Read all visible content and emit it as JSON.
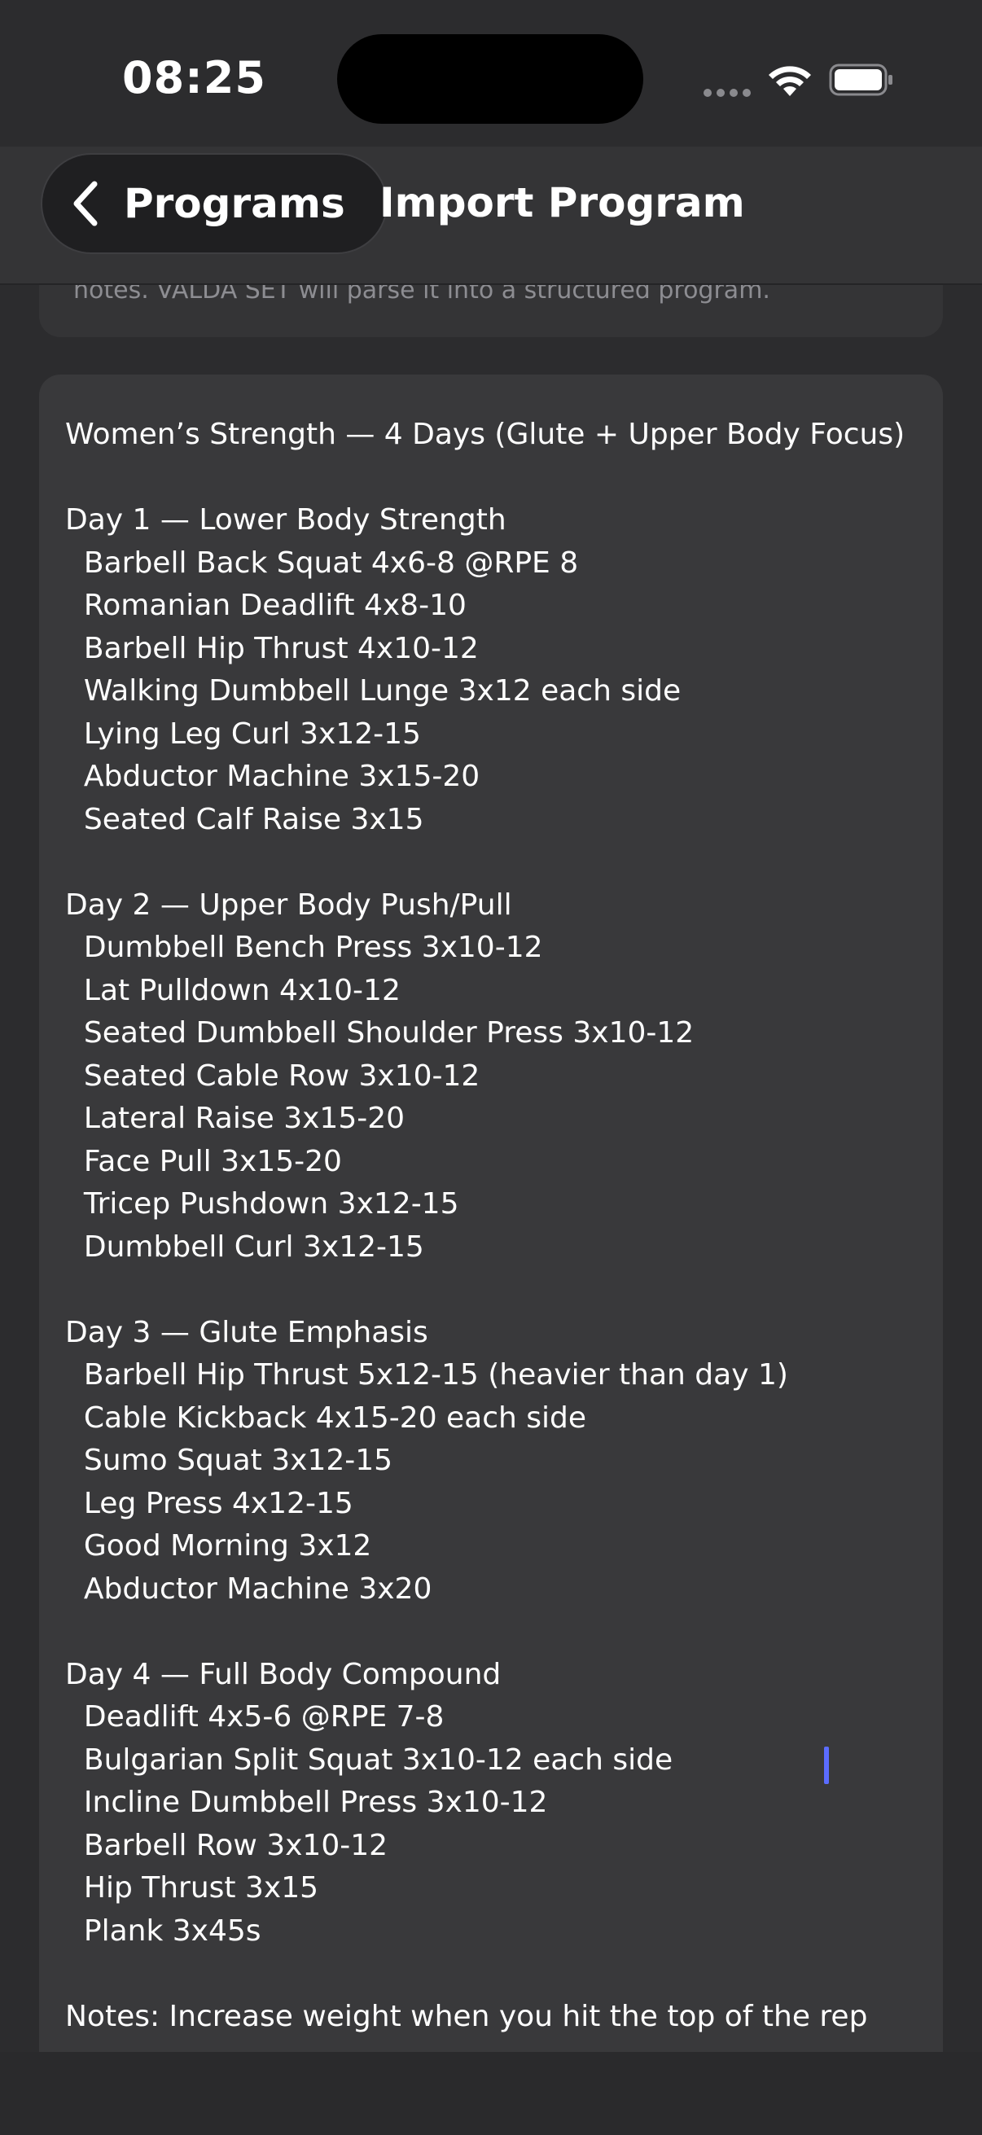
{
  "status_bar": {
    "time": "08:25"
  },
  "nav": {
    "back_label": "Programs",
    "title": "Import Program"
  },
  "info": {
    "text": "notes. VALDA SET will parse it into a structured program."
  },
  "editor": {
    "text": "Women’s Strength — 4 Days (Glute + Upper Body Focus)\n\nDay 1 — Lower Body Strength\n  Barbell Back Squat 4x6-8 @RPE 8\n  Romanian Deadlift 4x8-10\n  Barbell Hip Thrust 4x10-12\n  Walking Dumbbell Lunge 3x12 each side\n  Lying Leg Curl 3x12-15\n  Abductor Machine 3x15-20\n  Seated Calf Raise 3x15\n\nDay 2 — Upper Body Push/Pull\n  Dumbbell Bench Press 3x10-12\n  Lat Pulldown 4x10-12\n  Seated Dumbbell Shoulder Press 3x10-12\n  Seated Cable Row 3x10-12\n  Lateral Raise 3x15-20\n  Face Pull 3x15-20\n  Tricep Pushdown 3x12-15\n  Dumbbell Curl 3x12-15\n\nDay 3 — Glute Emphasis\n  Barbell Hip Thrust 5x12-15 (heavier than day 1)\n  Cable Kickback 4x15-20 each side\n  Sumo Squat 3x12-15\n  Leg Press 4x12-15\n  Good Morning 3x12\n  Abductor Machine 3x20\n\nDay 4 — Full Body Compound\n  Deadlift 4x5-6 @RPE 7-8\n  Bulgarian Split Squat 3x10-12 each side\n  Incline Dumbbell Press 3x10-12\n  Barbell Row 3x10-12\n  Hip Thrust 3x15\n  Plank 3x45s\n\nNotes: Increase weight when you hit the top of the rep"
  },
  "colors": {
    "background": "#2c2c2e",
    "card": "#39393b",
    "caret": "#5b6cff"
  }
}
